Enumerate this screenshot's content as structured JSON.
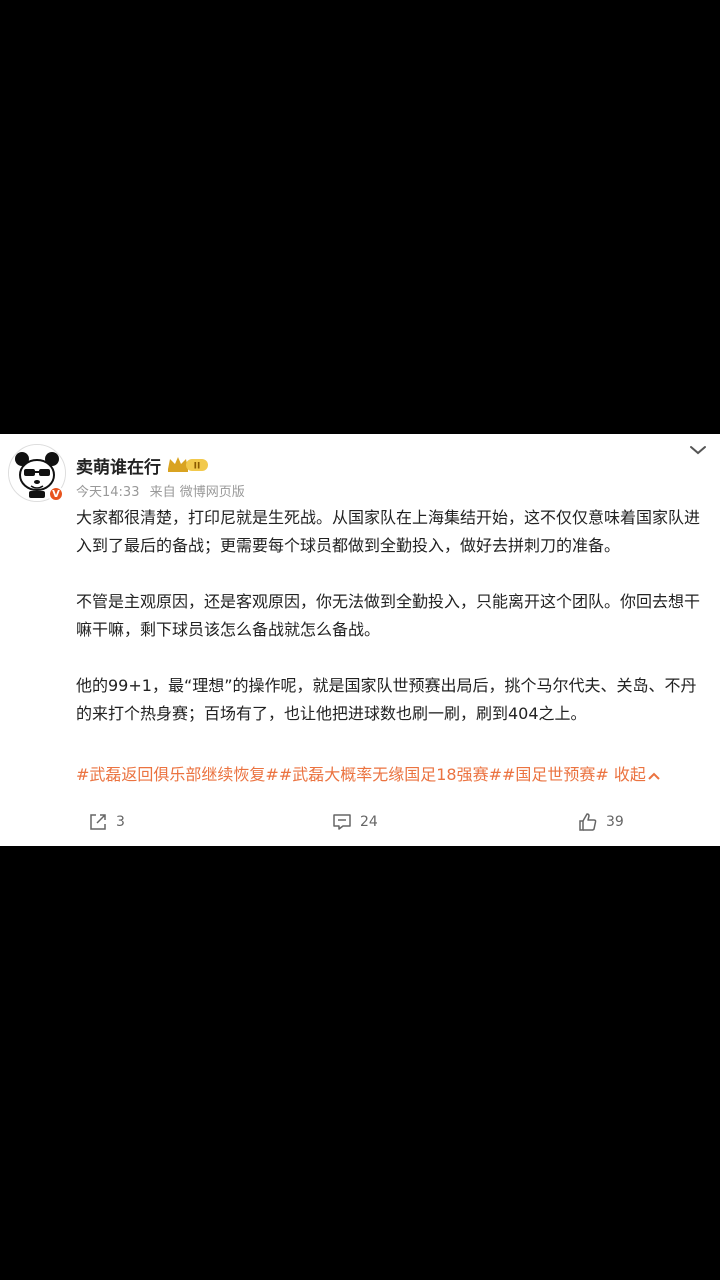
{
  "post": {
    "username": "卖萌谁在行",
    "time": "今天14:33",
    "source": "来自 微博网页版",
    "verified_badge": "V",
    "paragraphs": [
      "大家都很清楚，打印尼就是生死战。从国家队在上海集结开始，这不仅仅意味着国家队进入到了最后的备战；更需要每个球员都做到全勤投入，做好去拼刺刀的准备。",
      "不管是主观原因，还是客观原因，你无法做到全勤投入，只能离开这个团队。你回去想干嘛干嘛，剩下球员该怎么备战就怎么备战。",
      "他的99+1，最“理想”的操作呢，就是国家队世预赛出局后，挑个马尔代夫、关岛、不丹的来打个热身赛；百场有了，也让他把进球数也刷一刷，刷到404之上。"
    ],
    "tags": "#武磊返回俱乐部继续恢复##武磊大概率无缘国足18强赛##国足世预赛#",
    "collapse_label": "收起"
  },
  "actions": {
    "repost_count": "3",
    "comment_count": "24",
    "like_count": "39"
  },
  "colors": {
    "accent": "#eb7340",
    "badge": "#e8541e",
    "gold": "#d9a321"
  }
}
